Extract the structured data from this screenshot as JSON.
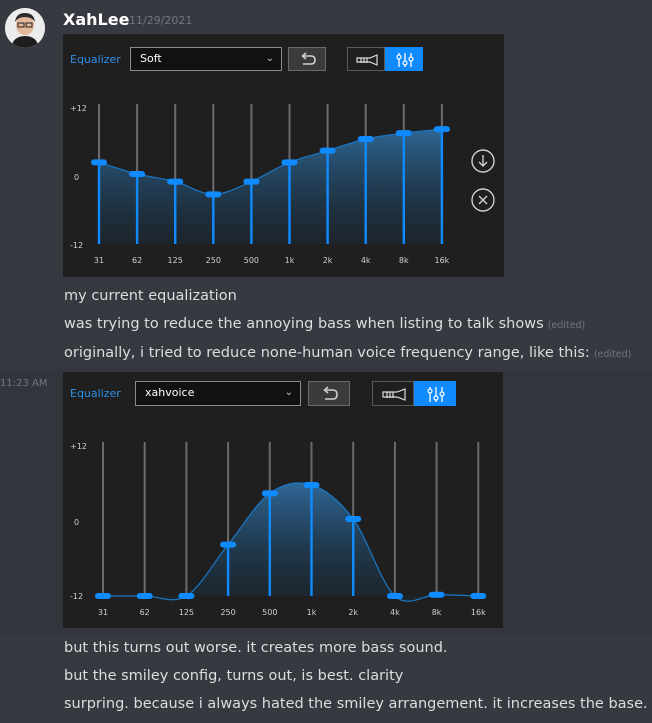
{
  "user": {
    "name": "XahLee",
    "date": "11/29/2021",
    "side_time": "11:23 AM"
  },
  "eq1": {
    "label": "Equalizer",
    "preset": "Soft",
    "y_labels": [
      "+12",
      "0",
      "-12"
    ],
    "ylim": [
      -12,
      12
    ],
    "frequencies": [
      "31",
      "62",
      "125",
      "250",
      "500",
      "1k",
      "2k",
      "4k",
      "8k",
      "16k"
    ],
    "values": [
      2,
      0,
      -1.3,
      -3.5,
      -1.3,
      2,
      4,
      6,
      7,
      7.7
    ],
    "side_icons": [
      "download-circle-icon",
      "close-circle-icon"
    ]
  },
  "eq2": {
    "label": "Equalizer",
    "preset": "xahvoice",
    "y_labels": [
      "+12",
      "0",
      "-12"
    ],
    "ylim": [
      -12,
      12
    ],
    "frequencies": [
      "31",
      "62",
      "125",
      "250",
      "500",
      "1k",
      "2k",
      "4k",
      "8k",
      "16k"
    ],
    "values": [
      -12,
      -12,
      -12,
      -4,
      4,
      5.3,
      0,
      -12,
      -11.8,
      -12
    ]
  },
  "messages": {
    "m1": "my current equalization",
    "m2": "was trying to reduce the annoying bass when listing to talk shows",
    "m2_edited": "(edited)",
    "m3": "originally, i tried to reduce none-human voice frequency range, like this:",
    "m3_edited": "(edited)",
    "m4": "but this turns out worse. it creates more bass sound.",
    "m5": "but the smiley config, turns out, is best. clarity",
    "m6": "surpring. because i always hated the smiley arrangement. it increases the base."
  },
  "colors": {
    "accent": "#0f8bff",
    "panel": "#1f1f1f",
    "bg": "#36393f"
  }
}
